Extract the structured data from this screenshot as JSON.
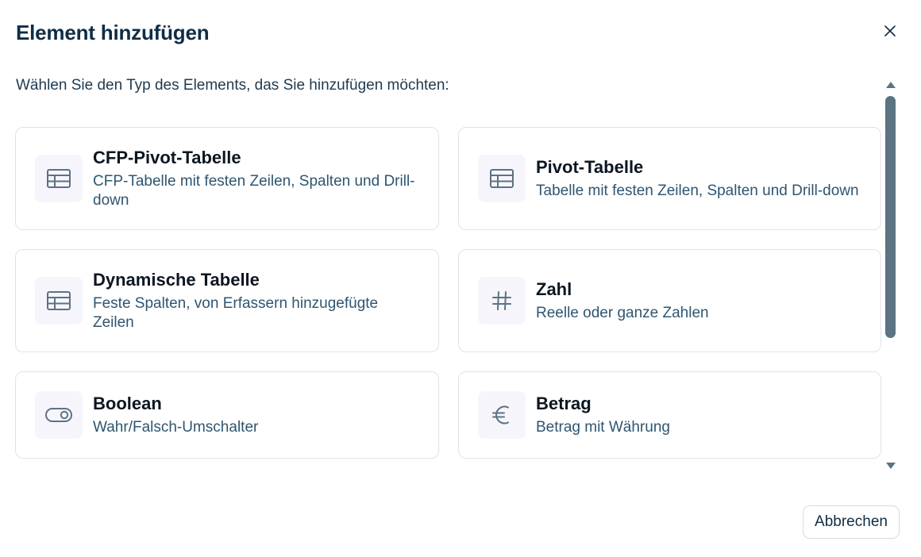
{
  "dialog": {
    "title": "Element hinzufügen",
    "subtitle": "Wählen Sie den Typ des Elements, das Sie hinzufügen möchten:",
    "close_icon": "close-icon",
    "cancel_label": "Abbrechen"
  },
  "colors": {
    "title": "#0f2d45",
    "description": "#2f5570",
    "icon": "#5b7382",
    "icon_background": "#f7f5fc",
    "card_border": "#dfe3e8",
    "scrollbar": "#5b7382"
  },
  "element_types": [
    {
      "title": "CFP-Pivot-Tabelle",
      "description": "CFP-Tabelle mit festen Zeilen, Spalten und Drill-down",
      "icon": "table-icon"
    },
    {
      "title": "Pivot-Tabelle",
      "description": "Tabelle mit festen Zeilen, Spalten und Drill-down",
      "icon": "table-icon"
    },
    {
      "title": "Dynamische Tabelle",
      "description": "Feste Spalten, von Erfassern hinzugefügte Zeilen",
      "icon": "table-icon"
    },
    {
      "title": "Zahl",
      "description": "Reelle oder ganze Zahlen",
      "icon": "hash-icon"
    },
    {
      "title": "Boolean",
      "description": "Wahr/Falsch-Umschalter",
      "icon": "toggle-icon"
    },
    {
      "title": "Betrag",
      "description": "Betrag mit Währung",
      "icon": "euro-icon"
    }
  ]
}
